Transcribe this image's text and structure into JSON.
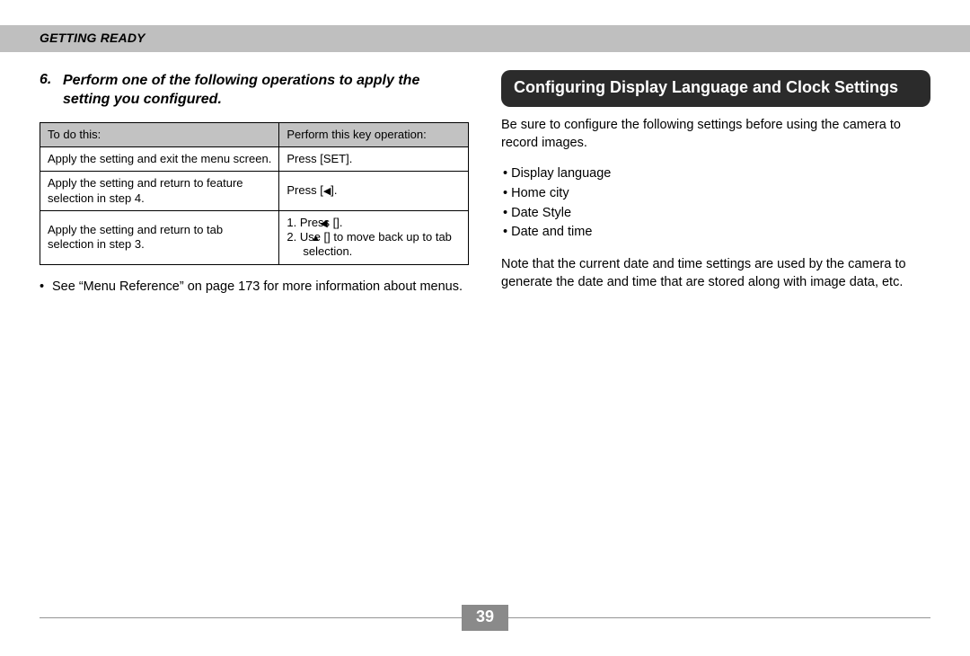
{
  "header": {
    "section": "GETTING READY"
  },
  "left": {
    "step_number": "6.",
    "step_text": "Perform one of the following operations to apply the setting you configured.",
    "table": {
      "head": [
        "To do this:",
        "Perform this key operation:"
      ],
      "rows": [
        {
          "todo": "Apply the setting and exit the menu screen.",
          "op_plain": "Press [SET]."
        },
        {
          "todo": "Apply the setting and return to feature selection in step 4.",
          "op_pre": "Press [",
          "op_glyph": "◀",
          "op_post": "]."
        },
        {
          "todo": "Apply the setting and return to tab selection in step 3.",
          "op_list": {
            "item1_pre": "1. Press [",
            "item1_glyph": "◀",
            "item1_post": "].",
            "item2_pre": "2. Use [",
            "item2_glyph": "▲",
            "item2_post": "] to move back up to tab selection."
          }
        }
      ]
    },
    "note": "See “Menu Reference” on page 173 for more information about menus."
  },
  "right": {
    "title": "Configuring Display Language and Clock Settings",
    "intro": "Be sure to configure the following settings before using the camera to record images.",
    "items": [
      "Display language",
      "Home city",
      "Date Style",
      "Date and time"
    ],
    "note": "Note that the current date and time settings are used by the camera to generate the date and time that are stored along with image data, etc."
  },
  "page_number": "39"
}
